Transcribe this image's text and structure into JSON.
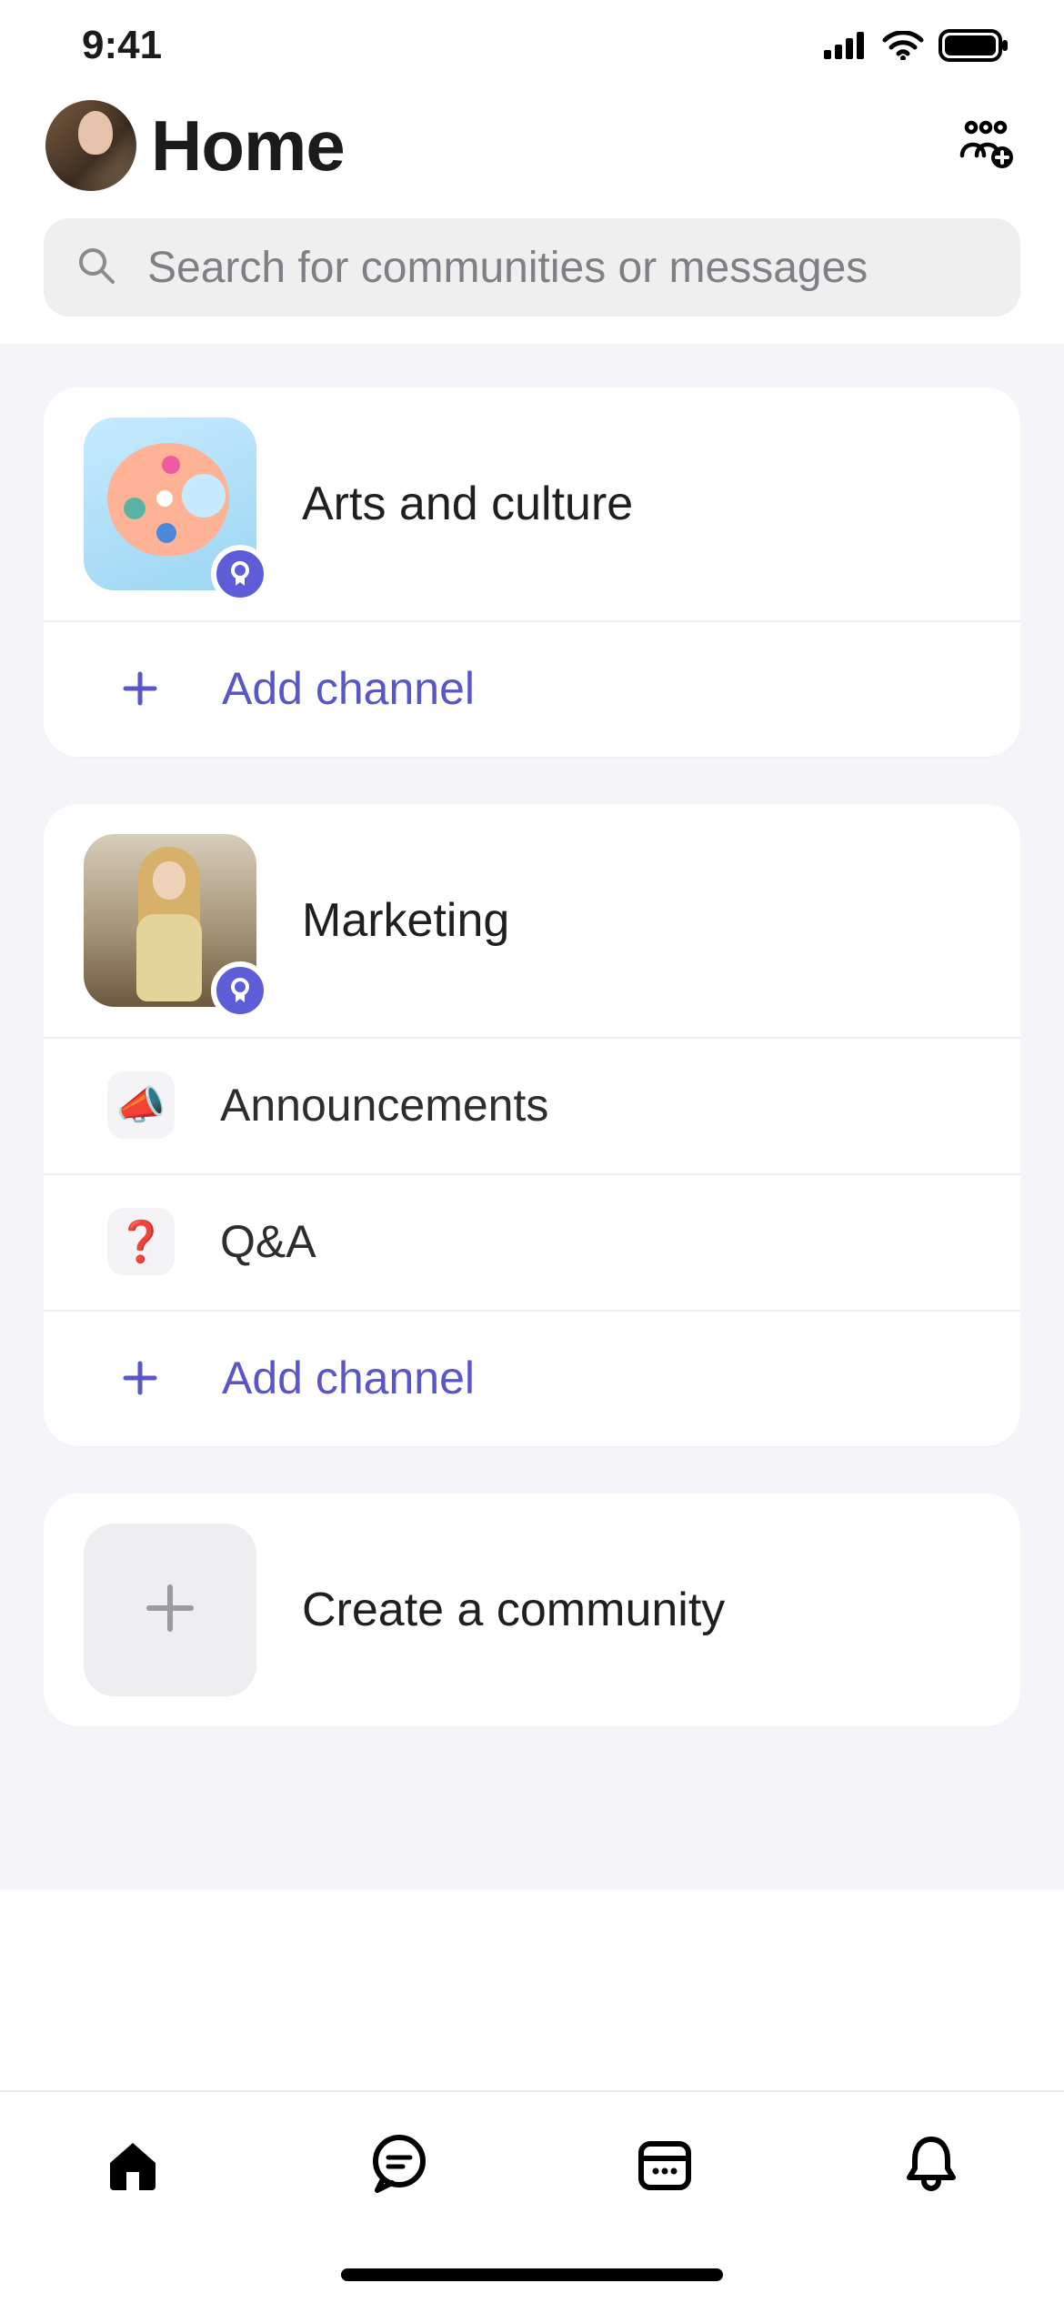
{
  "status": {
    "time": "9:41"
  },
  "header": {
    "title": "Home"
  },
  "search": {
    "placeholder": "Search for communities or messages"
  },
  "communities": [
    {
      "id": "arts",
      "name": "Arts and culture",
      "has_badge": true,
      "channels": [],
      "add_channel_label": "Add channel"
    },
    {
      "id": "marketing",
      "name": "Marketing",
      "has_badge": true,
      "channels": [
        {
          "id": "announcements",
          "name": "Announcements",
          "emoji": "📣"
        },
        {
          "id": "qa",
          "name": "Q&A",
          "emoji": "❓"
        }
      ],
      "add_channel_label": "Add channel"
    }
  ],
  "create_label": "Create a community",
  "tabs": [
    {
      "id": "home",
      "active": true
    },
    {
      "id": "chat",
      "active": false
    },
    {
      "id": "calendar",
      "active": false
    },
    {
      "id": "activity",
      "active": false
    }
  ],
  "colors": {
    "accent": "#5957c8",
    "badge": "#5e5dd8"
  }
}
